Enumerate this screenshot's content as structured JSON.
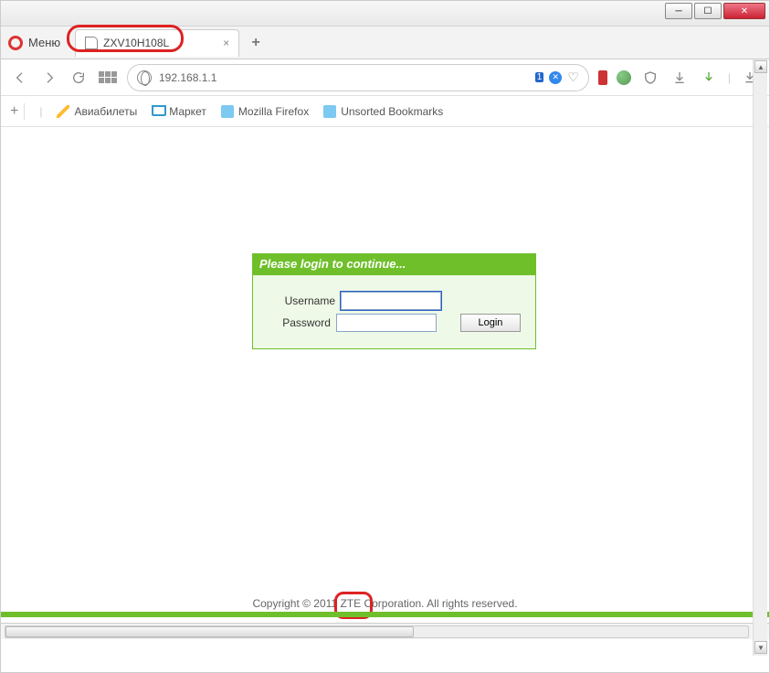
{
  "window": {
    "menu_label": "Меню"
  },
  "tab": {
    "title": "ZXV10H108L"
  },
  "navbar": {
    "url": "192.168.1.1",
    "badge_num": "1"
  },
  "bookmarks": {
    "items": [
      {
        "label": "Авиабилеты"
      },
      {
        "label": "Маркет"
      },
      {
        "label": "Mozilla Firefox"
      },
      {
        "label": "Unsorted Bookmarks"
      }
    ]
  },
  "login": {
    "header": "Please login to continue...",
    "username_label": "Username",
    "password_label": "Password",
    "button_label": "Login",
    "username_value": "",
    "password_value": ""
  },
  "footer": {
    "copyright_prefix": "Copyright © 2011 ",
    "brand": "ZTE",
    "copyright_suffix": " Corporation. All rights reserved."
  }
}
